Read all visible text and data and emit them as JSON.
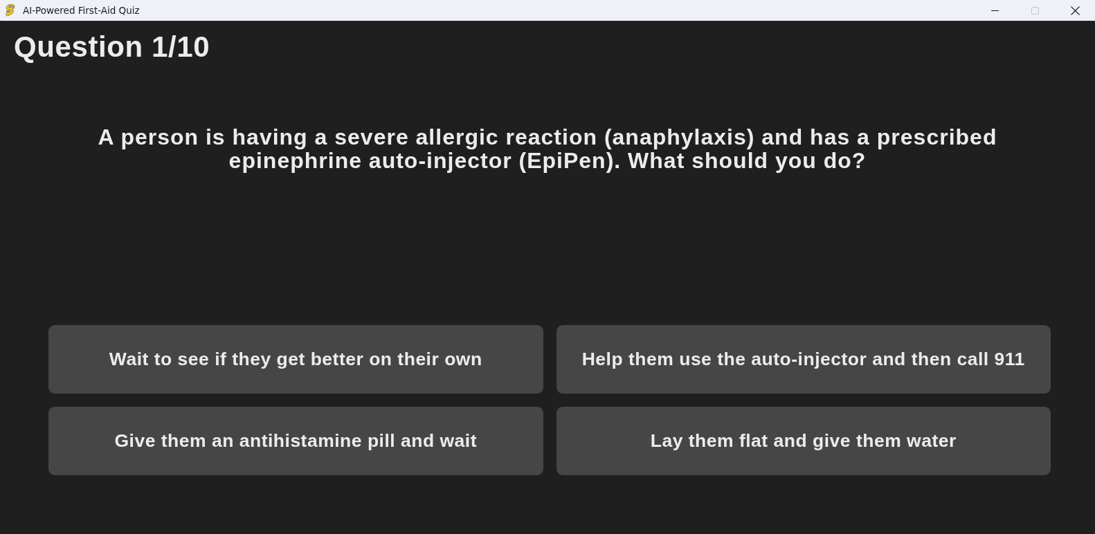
{
  "window": {
    "title": "AI-Powered First-Aid Quiz",
    "controls": [
      {
        "kind": "minimize",
        "disabled": false
      },
      {
        "kind": "maximize",
        "disabled": true
      },
      {
        "kind": "close",
        "disabled": false
      }
    ]
  },
  "quiz": {
    "heading": "Question 1/10",
    "question": "A person is having a severe allergic reaction (anaphylaxis) and has a prescribed epinephrine auto-injector (EpiPen). What should you do?",
    "answers": [
      "Wait to see if they get better on their own",
      "Help them use the auto-injector and then call 911",
      "Give them an antihistamine pill and wait",
      "Lay them flat and give them water"
    ]
  }
}
